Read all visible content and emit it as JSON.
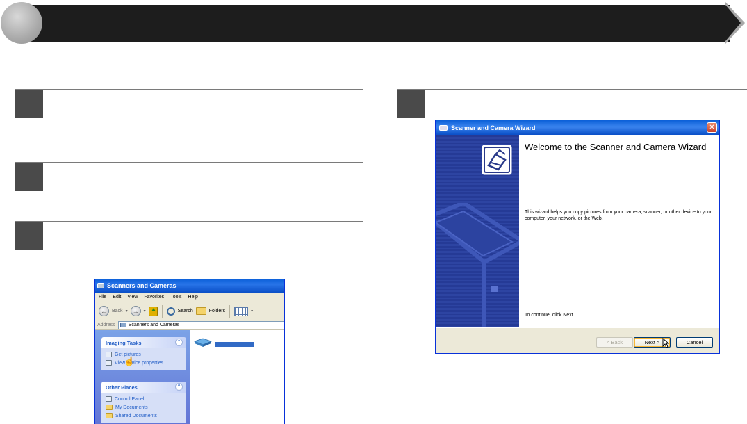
{
  "explorer": {
    "title": "Scanners and Cameras",
    "menu": [
      "File",
      "Edit",
      "View",
      "Favorites",
      "Tools",
      "Help"
    ],
    "toolbar": {
      "back": "Back",
      "search": "Search",
      "folders": "Folders"
    },
    "address_label": "Address",
    "address_value": "Scanners and Cameras",
    "imaging_tasks": {
      "title": "Imaging Tasks",
      "items": [
        "Get pictures",
        "View device properties"
      ]
    },
    "other_places": {
      "title": "Other Places",
      "items": [
        "Control Panel",
        "My Documents",
        "Shared Documents"
      ]
    }
  },
  "wizard": {
    "title": "Scanner and Camera Wizard",
    "heading": "Welcome to the Scanner and Camera Wizard",
    "body": "This wizard helps you copy pictures from your camera, scanner, or other device to your computer, your network, or the Web.",
    "continue_text": "To continue, click Next.",
    "buttons": {
      "back": "< Back",
      "next": "Next >",
      "cancel": "Cancel"
    },
    "close_glyph": "✕"
  },
  "colors": {
    "banner": "#1d1d1d",
    "step_square": "#4a4a4a",
    "xp_title_blue": "#0a5fd8",
    "wizard_side": "#253a96",
    "link_blue": "#215dc6"
  }
}
